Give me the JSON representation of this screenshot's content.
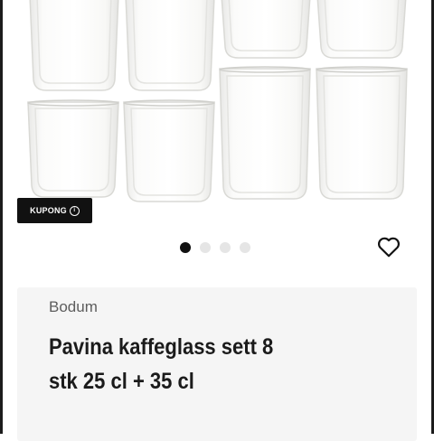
{
  "coupon": {
    "label": "KUPONG",
    "icon": "info-icon"
  },
  "carousel": {
    "page_count": 4,
    "active_index": 0
  },
  "favorite": {
    "icon": "heart-icon"
  },
  "product": {
    "brand": "Bodum",
    "title_line1": "Pavina kaffeglass sett 8",
    "title_line2": "stk 25 cl + 35 cl"
  }
}
